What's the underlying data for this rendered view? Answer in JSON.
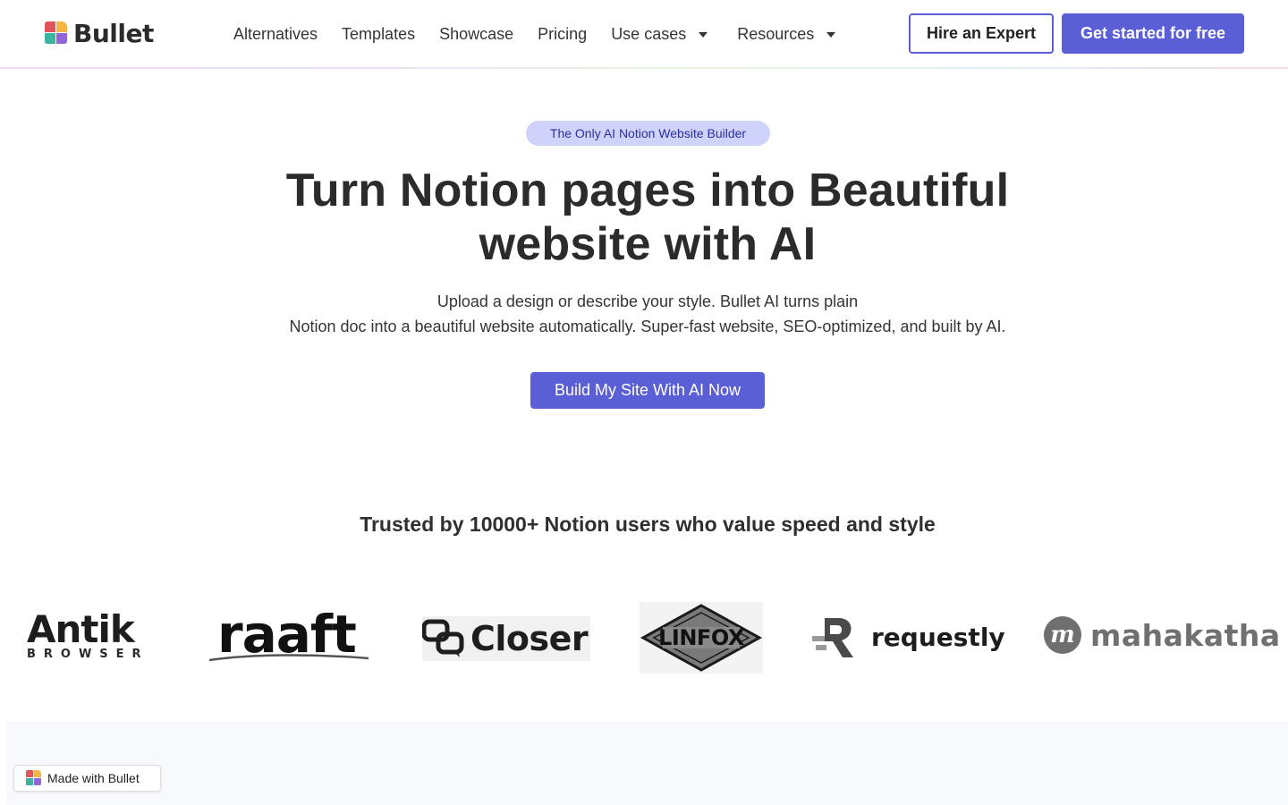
{
  "brand": {
    "name": "Bullet"
  },
  "nav": {
    "items": [
      {
        "label": "Alternatives"
      },
      {
        "label": "Templates"
      },
      {
        "label": "Showcase"
      },
      {
        "label": "Pricing"
      },
      {
        "label": "Use cases"
      },
      {
        "label": "Resources"
      }
    ],
    "hire_label": "Hire an Expert",
    "get_started_label": "Get started for free"
  },
  "hero": {
    "pill": "The Only AI Notion Website Builder",
    "title": "Turn Notion pages into Beautiful website with AI",
    "subtitle_line1": "Upload a design or describe your style. Bullet AI turns plain",
    "subtitle_line2": "Notion doc into a beautiful website automatically. Super-fast website, SEO-optimized, and built by AI.",
    "cta_label": "Build My Site With AI Now"
  },
  "trusted": {
    "text": "Trusted by 10000+ Notion users who value speed and style",
    "logos": {
      "antik_word": "Antik",
      "antik_sub": "BROWSER",
      "raaft": "raaft",
      "closer": "Closer",
      "linfox": "LINFOX",
      "requestly": "requestly",
      "mahakatha_mark": "m",
      "mahakatha": "mahakatha"
    }
  },
  "badge": {
    "label": "Made with Bullet"
  },
  "colors": {
    "accent": "#5b5fd6",
    "pill_bg": "#cfd3fb",
    "pill_text": "#2a2f9e"
  }
}
